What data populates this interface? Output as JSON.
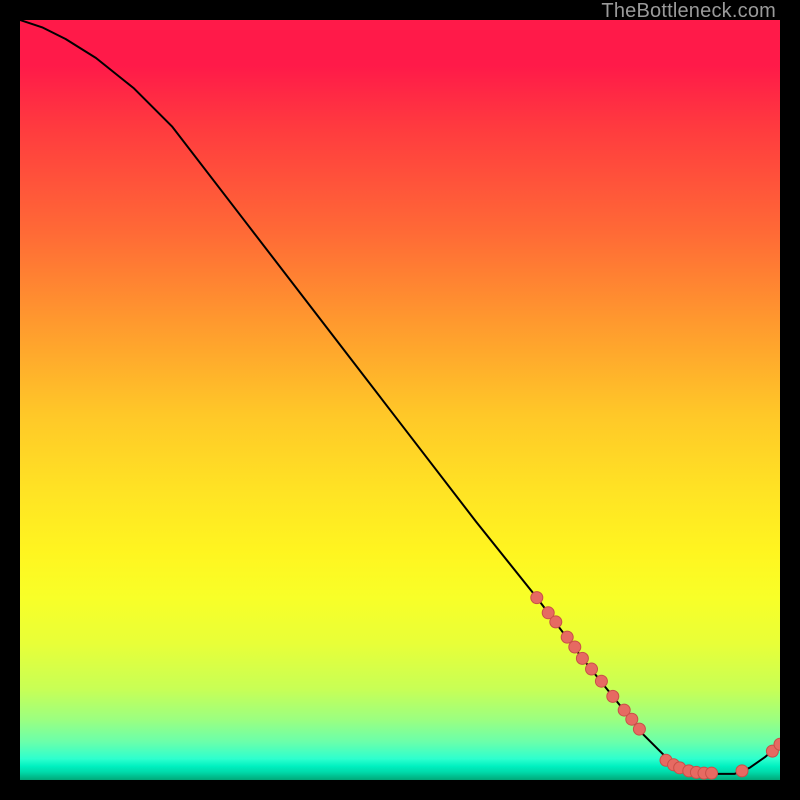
{
  "watermark": "TheBottleneck.com",
  "colors": {
    "curve_stroke": "#000000",
    "marker_fill": "#e66a62",
    "marker_stroke": "#c94f48",
    "background_border": "#000000"
  },
  "chart_data": {
    "type": "line",
    "title": "",
    "xlabel": "",
    "ylabel": "",
    "xlim": [
      0,
      100
    ],
    "ylim": [
      0,
      100
    ],
    "grid": false,
    "notes": "Background is a heatmap-style gradient (red at top through yellow to green at bottom). Black curve is bottleneck-vs-parameter style: high on left, falls roughly linearly, reaches a flat minimum near zero around x≈85–93, then rises slightly. Salmon markers appear on the curve only in the lower-right region.",
    "series": [
      {
        "name": "curve",
        "x": [
          0,
          3,
          6,
          10,
          15,
          20,
          30,
          40,
          50,
          60,
          68,
          74,
          78,
          82,
          85,
          88,
          90,
          92,
          94,
          96,
          98,
          100
        ],
        "y": [
          100,
          99,
          97.5,
          95,
          91,
          86,
          73,
          60,
          47,
          34,
          24,
          16,
          11,
          6,
          3,
          1.3,
          0.8,
          0.8,
          0.8,
          1.6,
          3.0,
          4.7
        ]
      }
    ],
    "markers": [
      {
        "x": 68.0,
        "y": 24.0
      },
      {
        "x": 69.5,
        "y": 22.0
      },
      {
        "x": 70.5,
        "y": 20.8
      },
      {
        "x": 72.0,
        "y": 18.8
      },
      {
        "x": 73.0,
        "y": 17.5
      },
      {
        "x": 74.0,
        "y": 16.0
      },
      {
        "x": 75.2,
        "y": 14.6
      },
      {
        "x": 76.5,
        "y": 13.0
      },
      {
        "x": 78.0,
        "y": 11.0
      },
      {
        "x": 79.5,
        "y": 9.2
      },
      {
        "x": 80.5,
        "y": 8.0
      },
      {
        "x": 81.5,
        "y": 6.7
      },
      {
        "x": 85.0,
        "y": 2.6
      },
      {
        "x": 86.0,
        "y": 2.0
      },
      {
        "x": 86.8,
        "y": 1.6
      },
      {
        "x": 88.0,
        "y": 1.2
      },
      {
        "x": 89.0,
        "y": 1.0
      },
      {
        "x": 90.0,
        "y": 0.9
      },
      {
        "x": 91.0,
        "y": 0.9
      },
      {
        "x": 95.0,
        "y": 1.2
      },
      {
        "x": 99.0,
        "y": 3.8
      },
      {
        "x": 100.0,
        "y": 4.7
      }
    ]
  }
}
